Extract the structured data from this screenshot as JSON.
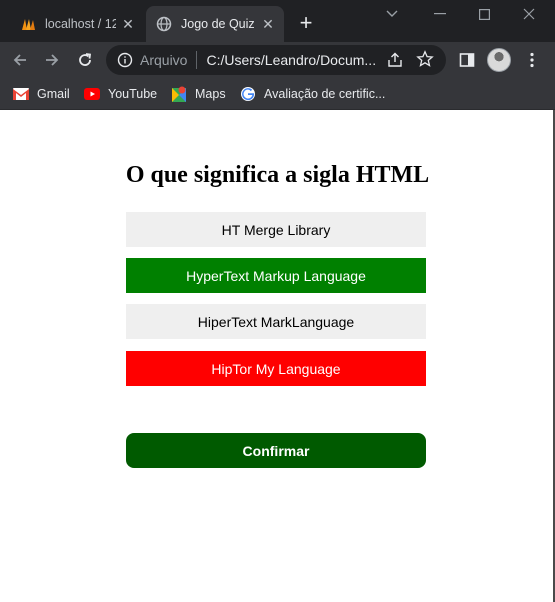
{
  "browser": {
    "tabs": [
      {
        "title": "localhost / 12",
        "active": false,
        "icon": "phpmyadmin-icon"
      },
      {
        "title": "Jogo de Quiz",
        "active": true,
        "icon": "globe-icon"
      }
    ],
    "omnibox": {
      "scheme": "Arquivo",
      "url": "C:/Users/Leandro/Docum..."
    },
    "bookmarks": [
      {
        "label": "Gmail",
        "icon": "gmail-icon"
      },
      {
        "label": "YouTube",
        "icon": "youtube-icon"
      },
      {
        "label": "Maps",
        "icon": "maps-icon"
      },
      {
        "label": "Avaliação de certific...",
        "icon": "google-icon"
      }
    ]
  },
  "quiz": {
    "question": "O que significa a sigla HTML",
    "answers": [
      {
        "label": "HT Merge Library",
        "state": "neutral"
      },
      {
        "label": "HyperText Markup Language",
        "state": "correct"
      },
      {
        "label": "HiperText MarkLanguage",
        "state": "neutral"
      },
      {
        "label": "HipTor My Language",
        "state": "wrong"
      }
    ],
    "confirm_label": "Confirmar"
  },
  "colors": {
    "neutral": "#efefef",
    "correct": "#008000",
    "wrong": "#ff0000",
    "confirm": "#005a00",
    "chrome_dark": "#202124",
    "chrome_toolbar": "#35363a"
  }
}
